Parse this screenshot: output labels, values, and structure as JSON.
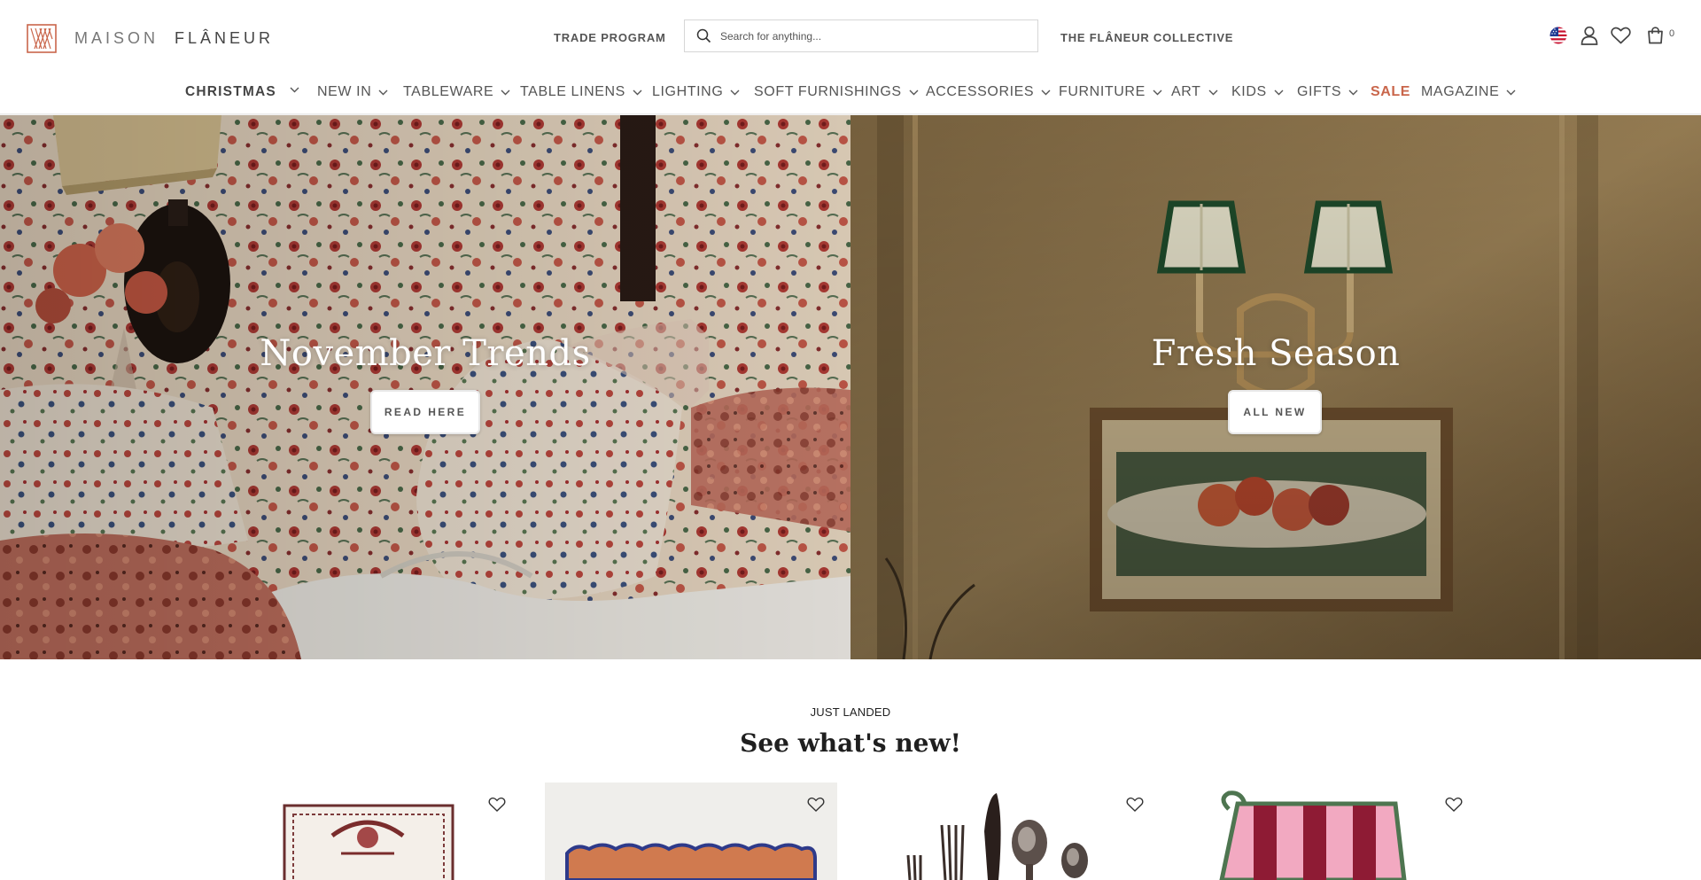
{
  "brand": {
    "name_light": "MAISON",
    "name_bold": "FLÂNEUR",
    "accent": "#c9664b"
  },
  "header": {
    "trade_label": "TRADE PROGRAM",
    "search_placeholder": "Search for anything...",
    "collective_label": "THE FLÂNEUR COLLECTIVE",
    "cart_count": "0",
    "icons": [
      "us-flag-icon",
      "user-icon",
      "heart-icon",
      "cart-icon"
    ]
  },
  "nav": {
    "items": [
      {
        "label": "CHRISTMAS"
      },
      {
        "label": "NEW IN"
      },
      {
        "label": "TABLEWARE"
      },
      {
        "label": "TABLE LINENS"
      },
      {
        "label": "LIGHTING"
      },
      {
        "label": "SOFT FURNISHINGS"
      },
      {
        "label": "ACCESSORIES"
      },
      {
        "label": "FURNITURE"
      },
      {
        "label": "ART"
      },
      {
        "label": "KIDS"
      },
      {
        "label": "GIFTS"
      },
      {
        "label": "SALE"
      },
      {
        "label": "MAGAZINE"
      }
    ]
  },
  "hero": {
    "left": {
      "title": "November Trends",
      "button": "READ HERE"
    },
    "right": {
      "title": "Fresh Season",
      "button": "ALL NEW"
    }
  },
  "just_landed": {
    "eyebrow": "JUST LANDED",
    "title": "See what's new!",
    "products": [
      {
        "image": "decorative-scarf-print"
      },
      {
        "image": "scalloped-placemat"
      },
      {
        "image": "cutlery-set"
      },
      {
        "image": "striped-oven-glove"
      }
    ]
  }
}
